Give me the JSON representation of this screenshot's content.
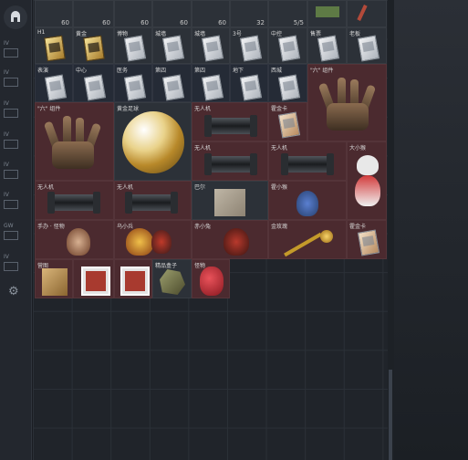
{
  "top_row": {
    "counts": [
      "60",
      "60",
      "60",
      "60",
      "60",
      "32",
      "5/5"
    ]
  },
  "rows": [
    [
      "H1",
      "黄",
      "",
      "",
      "",
      "3号",
      "中控",
      "售票",
      "老板"
    ],
    [
      "表演",
      "中心",
      "医务",
      "第四",
      "",
      "地下",
      "西城",
      ""
    ],
    [
      "",
      "",
      "",
      "",
      "",
      "",
      "",
      ""
    ],
    [
      "",
      "黄金足球",
      "天人",
      "",
      "霍金",
      "",
      "",
      ""
    ],
    [
      "",
      "",
      "天人",
      "",
      "天人",
      "",
      "大小姐",
      ""
    ],
    [
      "天人",
      "",
      "",
      "巴尔",
      "",
      "霍小猴",
      "",
      ""
    ],
    [
      "手办",
      "",
      "乌小兵",
      "",
      "赤小兔",
      "",
      "金玫瑰",
      "",
      "霍金卡"
    ],
    [
      "营图",
      "",
      "",
      "",
      "精品",
      "",
      "",
      ""
    ]
  ],
  "labels": {
    "hand1": "\"六\" 组件",
    "hand2": "\"六\" 组件",
    "ball": "黄金足球",
    "sil1": "无人机",
    "sil2": "无人机",
    "sil3": "无人机",
    "sil4": "无人机",
    "sil5": "无人机",
    "card_r3": "霍金卡",
    "map": "巴尔",
    "fig_blue": "霍小猴",
    "fig_dad": "大小猴",
    "fig1": "手办 · 怪物",
    "fig2": "乌小兵",
    "fig3": "赤小兔",
    "rose": "金玫瑰",
    "card_gold2": "霍金卡",
    "b1": "营图",
    "b4": "精品盒子",
    "b5": "怪物",
    "h1": "H1",
    "h2": "黄金",
    "h3": "博物",
    "h4": "城墙",
    "h5": "城墙",
    "h6": "3号",
    "h7": "中控",
    "h8": "售票",
    "h9": "老板",
    "r2a": "表演",
    "r2b": "中心",
    "r2c": "医务",
    "r2d": "第四",
    "r2e": "第四",
    "r2f": "地下",
    "r2g": "西城"
  },
  "tabs": [
    "IV",
    "IV",
    "IV",
    "IV",
    "IV",
    "IV",
    "GW",
    "IV"
  ]
}
